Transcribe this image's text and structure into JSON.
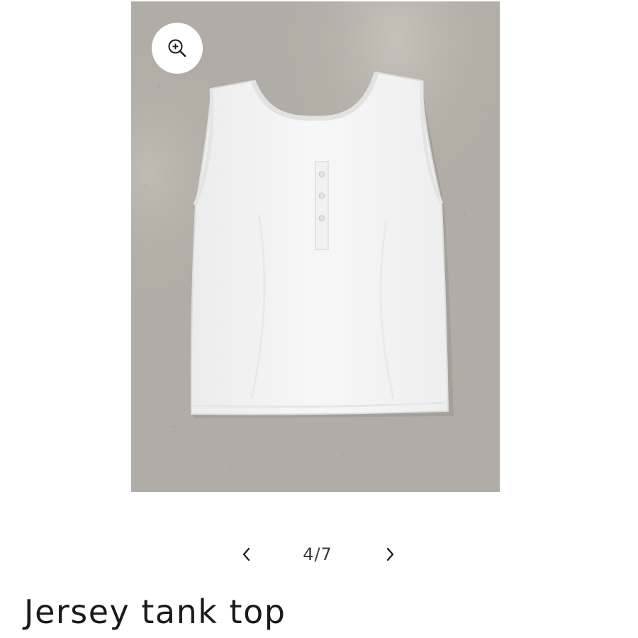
{
  "gallery": {
    "image": {
      "alt": "White sleeveless jersey tank top with henley button placket laid flat on grey carpet",
      "background_color": "#b1aca5",
      "garment_color": "#f4f4f4"
    },
    "zoom_icon": "zoom-in-icon",
    "pager": {
      "prev_icon": "chevron-left-icon",
      "count": "4/7",
      "next_icon": "chevron-right-icon"
    }
  },
  "product": {
    "title": "Jersey tank top"
  }
}
